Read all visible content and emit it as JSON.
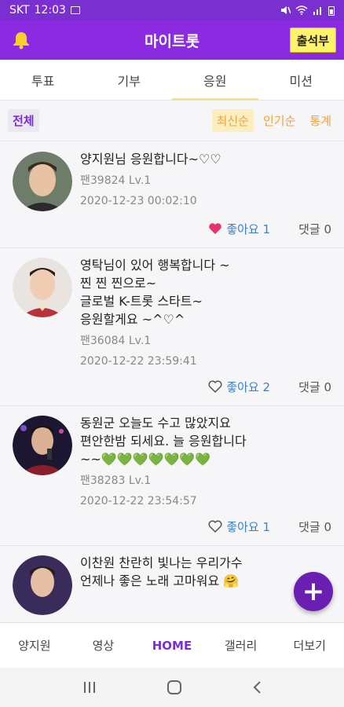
{
  "statusbar": {
    "carrier": "SKT",
    "time": "12:03"
  },
  "appbar": {
    "title": "마이트롯",
    "attendance_button": "출석부"
  },
  "tabs": [
    {
      "label": "투표"
    },
    {
      "label": "기부"
    },
    {
      "label": "응원",
      "active": true
    },
    {
      "label": "미션"
    }
  ],
  "filter": {
    "all_label": "전체",
    "sort_latest": "최신순",
    "sort_popular": "인기순",
    "stats": "통계"
  },
  "posts": [
    {
      "message": "양지원님 응원합니다~♡♡",
      "author": "팬39824 Lv.1",
      "datetime": "2020-12-23 00:02:10",
      "likes_label": "좋아요 1",
      "liked": true,
      "comments_label": "댓글 0"
    },
    {
      "message": "영탁님이 있어 행복합니다 ~\n찐 찐 찐으로~\n글로벌 K-트롯 스타트~\n응원할게요 ~^♡^",
      "author": "팬36084 Lv.1",
      "datetime": "2020-12-22 23:59:41",
      "likes_label": "좋아요 2",
      "liked": false,
      "comments_label": "댓글 0"
    },
    {
      "message": "동원군 오늘도 수고 많았지요\n편안한밤 되세요. 늘 응원합니다\n~~💚💚💚💚💚💚💚",
      "author": "팬38283 Lv.1",
      "datetime": "2020-12-22 23:54:57",
      "likes_label": "좋아요 1",
      "liked": false,
      "comments_label": "댓글 0"
    },
    {
      "message": "이찬원 찬란히 빛나는 우리가수\n언제나 좋은 노래 고마워요 🤗",
      "author": "",
      "datetime": "",
      "likes_label": "",
      "liked": false,
      "comments_label": ""
    }
  ],
  "fab": {
    "label": "+"
  },
  "bottom_nav": [
    {
      "label": "양지원"
    },
    {
      "label": "영상"
    },
    {
      "label": "HOME",
      "active": true
    },
    {
      "label": "갤러리"
    },
    {
      "label": "더보기"
    }
  ],
  "colors": {
    "primary": "#8a2be2",
    "statusbar": "#7a2fd0",
    "accent_yellow": "#fff36b",
    "sort_orange": "#f2a23a",
    "like_blue": "#3b7fc4",
    "heart_pink": "#e8336d"
  },
  "icons": {
    "bell": "bell-icon",
    "heart_filled": "heart-filled-icon",
    "heart_outline": "heart-outline-icon",
    "plus": "plus-icon"
  }
}
